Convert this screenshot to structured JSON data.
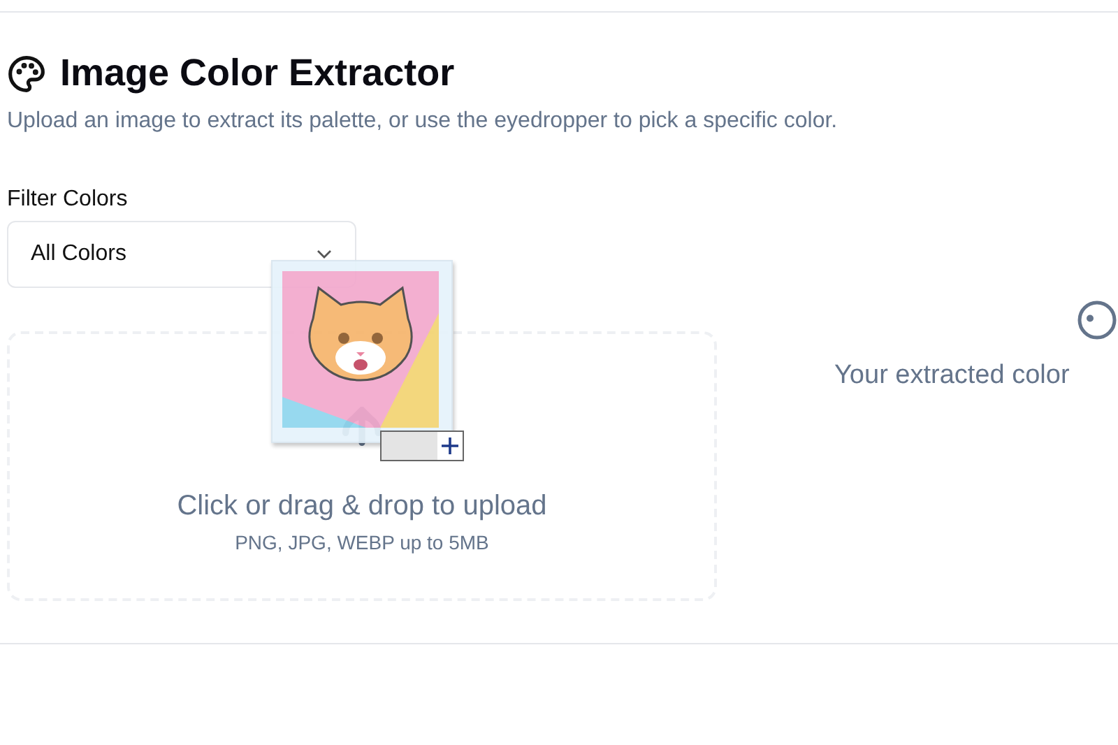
{
  "header": {
    "title": "Image Color Extractor",
    "subtitle": "Upload an image to extract its palette, or use the eyedropper to pick a specific color."
  },
  "filter": {
    "label": "Filter Colors",
    "value": "All Colors"
  },
  "upload": {
    "prompt": "Click or drag & drop to upload",
    "hint": "PNG, JPG, WEBP up to 5MB"
  },
  "palette_panel": {
    "empty_text": "Your extracted color"
  }
}
